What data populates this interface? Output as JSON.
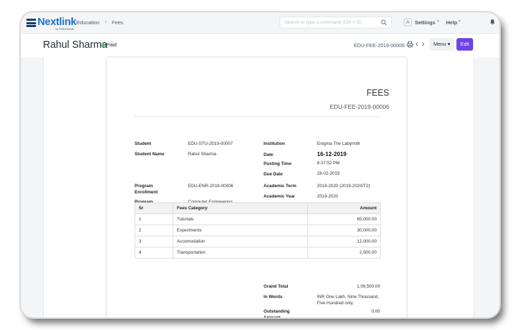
{
  "navbar": {
    "brand": "Nextlink",
    "brand_sub": "by Sutherlands",
    "breadcrumbs": [
      "Education",
      "Fees"
    ],
    "search_placeholder": "Search or type a command (Ctrl + G)",
    "avatar_letter": "A",
    "settings": "Settings",
    "help": "Help"
  },
  "page": {
    "title": "Rahul Sharma",
    "status": "Paid",
    "doc_name": "EDU-FEE-2019-00006",
    "menu_label": "Menu",
    "edit_label": "Edit"
  },
  "doc": {
    "heading": "FEES",
    "doc_id": "EDU-FEE-2019-00006",
    "left_fields": [
      {
        "label": "Student",
        "value": "EDU-STU-2019-00007"
      },
      {
        "label": "Student Name",
        "value": "Rahul Sharma"
      },
      {
        "label": "Program Enrollment",
        "value": "EDU-ENR-2019-00006"
      },
      {
        "label": "Program",
        "value": "Computer Engineering"
      }
    ],
    "right_fields": [
      {
        "label": "Institution",
        "value": "Enigma The Labyrinth"
      },
      {
        "label": "Date",
        "value": "16-12-2019"
      },
      {
        "label": "Posting Time",
        "value": "8:37:52 PM"
      },
      {
        "label": "Due Date",
        "value": "28-02-2019"
      },
      {
        "label": "Academic Term",
        "value": "2019-2020 (2019-2020/T2)"
      },
      {
        "label": "Academic Year",
        "value": "2019-2020"
      }
    ],
    "table": {
      "headers": [
        "Sr",
        "Fees Category",
        "Amount"
      ],
      "rows": [
        [
          "1",
          "Tutorials",
          "65,000.00"
        ],
        [
          "2",
          "Experiments",
          "30,000.00"
        ],
        [
          "3",
          "Accomodation",
          "12,000.00"
        ],
        [
          "4",
          "Transportation",
          "2,500.00"
        ]
      ]
    },
    "totals": [
      {
        "label": "Grand Total",
        "value": "1,09,500.00"
      },
      {
        "label": "In Words",
        "value": "INR One Lakh, Nine Thousand, Five Hundred only."
      },
      {
        "label": "Outstanding Amount",
        "value": "0.00"
      }
    ]
  },
  "colors": {
    "primary": "#6f42e8",
    "status_paid": "#48bb74",
    "brand": "#1a73c8"
  }
}
